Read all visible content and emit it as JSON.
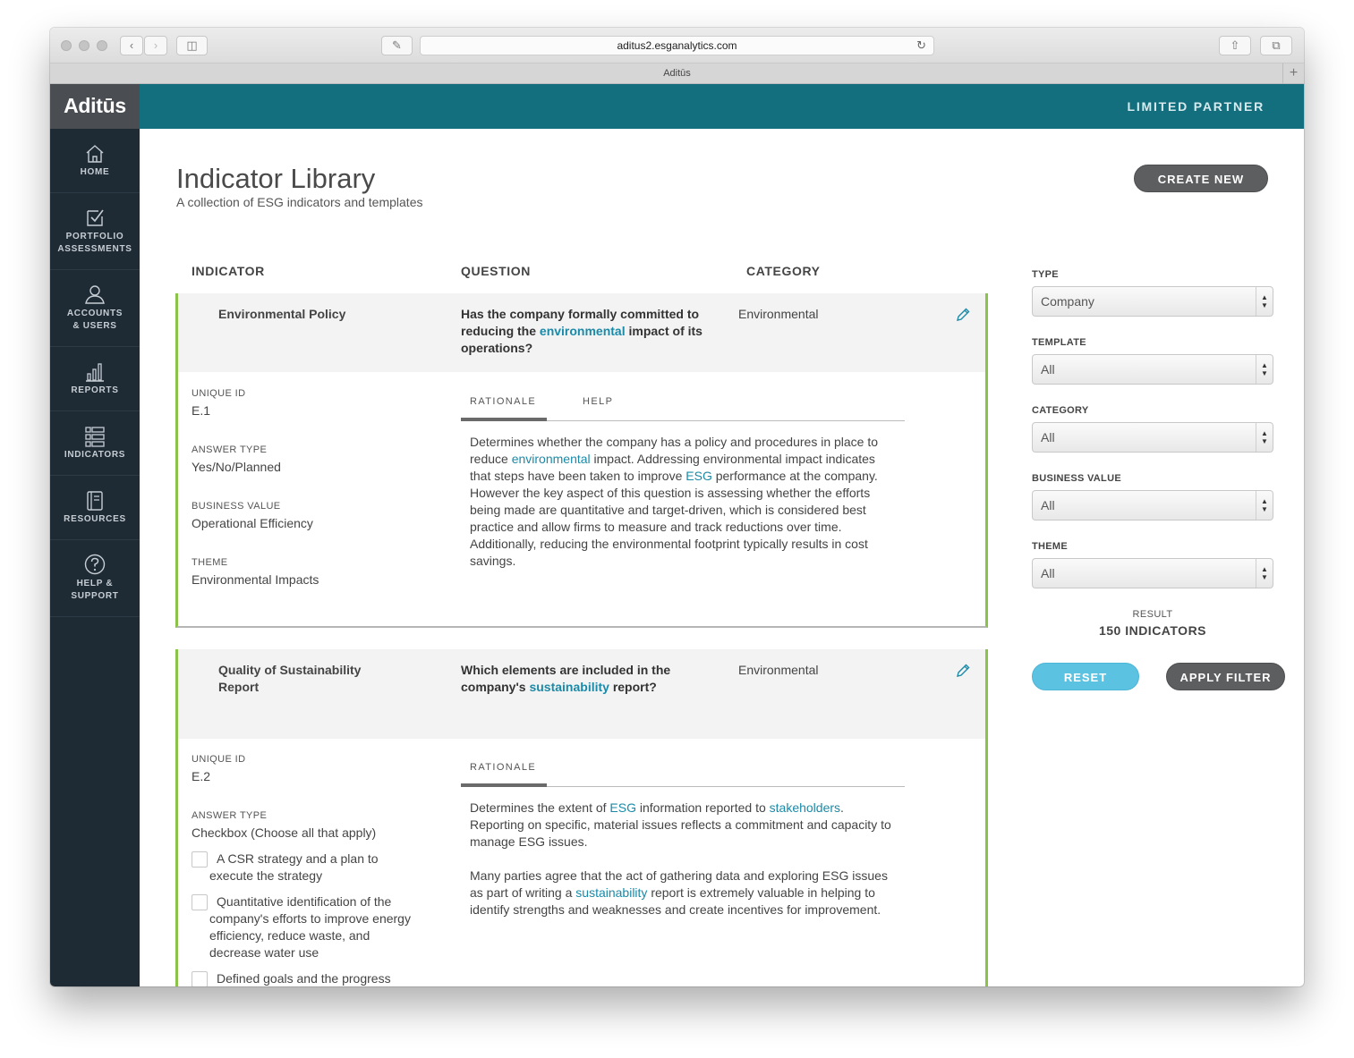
{
  "browser": {
    "url": "aditus2.esganalytics.com",
    "tab_title": "Aditūs"
  },
  "app": {
    "brand": "Aditūs",
    "role": "LIMITED PARTNER",
    "colors": {
      "header": "#136e7e",
      "sidebar": "#1e2b35",
      "accent_green": "#8bc34a",
      "link": "#1a8aa8",
      "reset": "#5bc2e2"
    }
  },
  "sidebar": {
    "items": [
      {
        "icon": "home-icon",
        "line1": "HOME",
        "line2": ""
      },
      {
        "icon": "checkbox-icon",
        "line1": "PORTFOLIO",
        "line2": "ASSESSMENTS"
      },
      {
        "icon": "user-icon",
        "line1": "ACCOUNTS",
        "line2": "& USERS"
      },
      {
        "icon": "bar-chart-icon",
        "line1": "REPORTS",
        "line2": ""
      },
      {
        "icon": "list-icon",
        "line1": "INDICATORS",
        "line2": ""
      },
      {
        "icon": "book-icon",
        "line1": "RESOURCES",
        "line2": ""
      },
      {
        "icon": "help-icon",
        "line1": "HELP &",
        "line2": "SUPPORT"
      }
    ]
  },
  "page": {
    "title": "Indicator Library",
    "subtitle": "A collection of ESG indicators and templates",
    "create_label": "CREATE NEW"
  },
  "table": {
    "headers": {
      "indicator": "INDICATOR",
      "question": "QUESTION",
      "category": "CATEGORY"
    }
  },
  "indicators": [
    {
      "name": "Environmental Policy",
      "question": {
        "pre": "Has the company formally committed to reducing the ",
        "link": "environmental",
        "post": " impact of its operations?"
      },
      "category": "Environmental",
      "unique_id_label": "UNIQUE ID",
      "unique_id": "E.1",
      "answer_type_label": "ANSWER TYPE",
      "answer_type": "Yes/No/Planned",
      "business_value_label": "BUSINESS VALUE",
      "business_value": "Operational Efficiency",
      "theme_label": "THEME",
      "theme": "Environmental Impacts",
      "tabs": [
        "RATIONALE",
        "HELP"
      ],
      "rationale": {
        "t1": "Determines whether the company has a policy and procedures in place to reduce ",
        "l1": "environmental",
        "t2": " impact. Addressing environmental impact indicates that steps have been taken to improve ",
        "l2": "ESG",
        "t3": " performance at the company. However the key aspect of this question is assessing whether the efforts being made are quantitative and target-driven, which is considered best practice and allow firms to measure and track reductions over time. Additionally, reducing the environmental footprint typically results in cost savings."
      }
    },
    {
      "name": "Quality of Sustainability Report",
      "question": {
        "pre": "Which elements are included in the company's ",
        "link": "sustainability",
        "post": " report?"
      },
      "category": "Environmental",
      "unique_id_label": "UNIQUE ID",
      "unique_id": "E.2",
      "answer_type_label": "ANSWER TYPE",
      "answer_type": "Checkbox (Choose all that apply)",
      "options": [
        "A CSR strategy and a plan to execute the strategy",
        "Quantitative identification of the company's efforts to improve energy efficiency, reduce waste, and decrease water use",
        "Defined goals and the progress made towards the goals"
      ],
      "tabs": [
        "RATIONALE"
      ],
      "rationale": {
        "p1_t1": "Determines the extent of ",
        "p1_l1": "ESG",
        "p1_t2": " information reported to ",
        "p1_l2": "stakeholders",
        "p1_t3": ". Reporting on specific, material issues reflects a commitment and capacity to manage ESG issues.",
        "p2_t1": "Many parties agree that the act of gathering data and exploring ESG issues as part of writing a ",
        "p2_l1": "sustainability",
        "p2_t2": " report is extremely valuable in helping to identify strengths and weaknesses and create incentives for improvement."
      }
    }
  ],
  "filters": {
    "type_label": "TYPE",
    "type_value": "Company",
    "template_label": "TEMPLATE",
    "template_value": "All",
    "category_label": "CATEGORY",
    "category_value": "All",
    "business_value_label": "BUSINESS VALUE",
    "business_value_value": "All",
    "theme_label": "THEME",
    "theme_value": "All",
    "result_label": "RESULT",
    "result_value": "150 INDICATORS",
    "reset_label": "RESET",
    "apply_label": "APPLY FILTER"
  }
}
